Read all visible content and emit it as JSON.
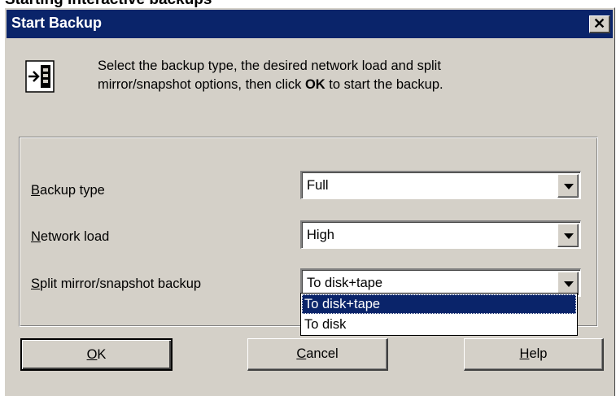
{
  "heading": "Starting interactive backups",
  "dialog": {
    "title": "Start Backup",
    "close_label": "✕",
    "icon": "backup-start-icon",
    "info": {
      "part1": "Select the backup type, the desired network load and split",
      "part2": "mirror/snapshot options, then click ",
      "ok_word": "OK",
      "part3": " to start the backup."
    },
    "fields": {
      "backup_type": {
        "label_accel": "B",
        "label_rest": "ackup type",
        "value": "Full"
      },
      "network_load": {
        "label_accel": "N",
        "label_rest": "etwork load",
        "value": "High"
      },
      "split_mirror": {
        "label_accel": "S",
        "label_rest": "plit mirror/snapshot backup",
        "value": "To disk+tape",
        "options": [
          "To disk+tape",
          "To disk"
        ]
      }
    },
    "buttons": {
      "ok": {
        "accel": "O",
        "rest": "K"
      },
      "cancel": {
        "accel": "C",
        "rest": "ancel"
      },
      "help": {
        "accel": "H",
        "rest": "elp"
      }
    }
  },
  "colors": {
    "titlebar": "#0a246a",
    "face": "#d4d0c8",
    "selection": "#0a246a"
  }
}
